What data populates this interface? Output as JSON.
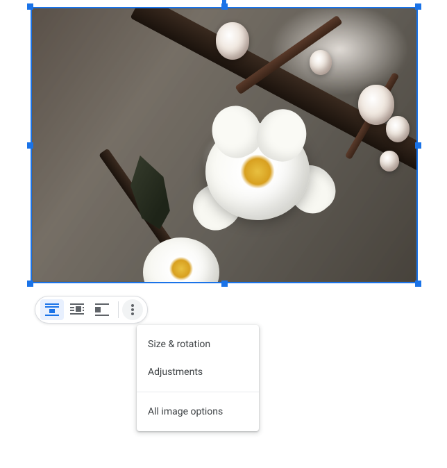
{
  "selection": {
    "color": "#1a73e8"
  },
  "toolbar": {
    "wrap_inline": "In line",
    "wrap_text": "Wrap text",
    "wrap_break": "Break text",
    "more": "More image options"
  },
  "menu": {
    "size_rotation": "Size & rotation",
    "adjustments": "Adjustments",
    "all_options": "All image options"
  }
}
